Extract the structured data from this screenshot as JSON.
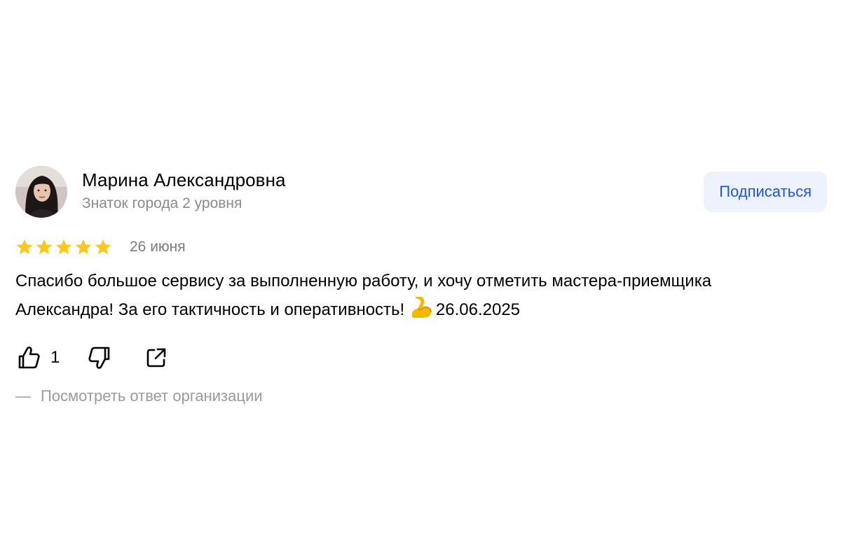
{
  "author": {
    "name": "Марина Александровна",
    "level": "Знаток города 2 уровня"
  },
  "subscribe_label": "Подписаться",
  "rating": {
    "stars": 5,
    "max": 5,
    "star_color": "#fcc81e"
  },
  "date": "26 июня",
  "review_text": {
    "before_emoji": "Спасибо большое сервису за выполненную работу, и хочу отметить мастера-приемщика Александра! За его тактичность и оперативность! ",
    "emoji_icon": "flexed-biceps-icon",
    "after_emoji": "26.06.2025"
  },
  "actions": {
    "like_count": "1",
    "like_icon": "thumbs-up-icon",
    "dislike_icon": "thumbs-down-icon",
    "share_icon": "share-icon"
  },
  "org_reply": {
    "dash": "—",
    "label": "Посмотреть ответ организации"
  },
  "colors": {
    "accent": "#1f55d9",
    "button_bg": "#eef2fc",
    "muted_text": "#8a8a8f"
  }
}
